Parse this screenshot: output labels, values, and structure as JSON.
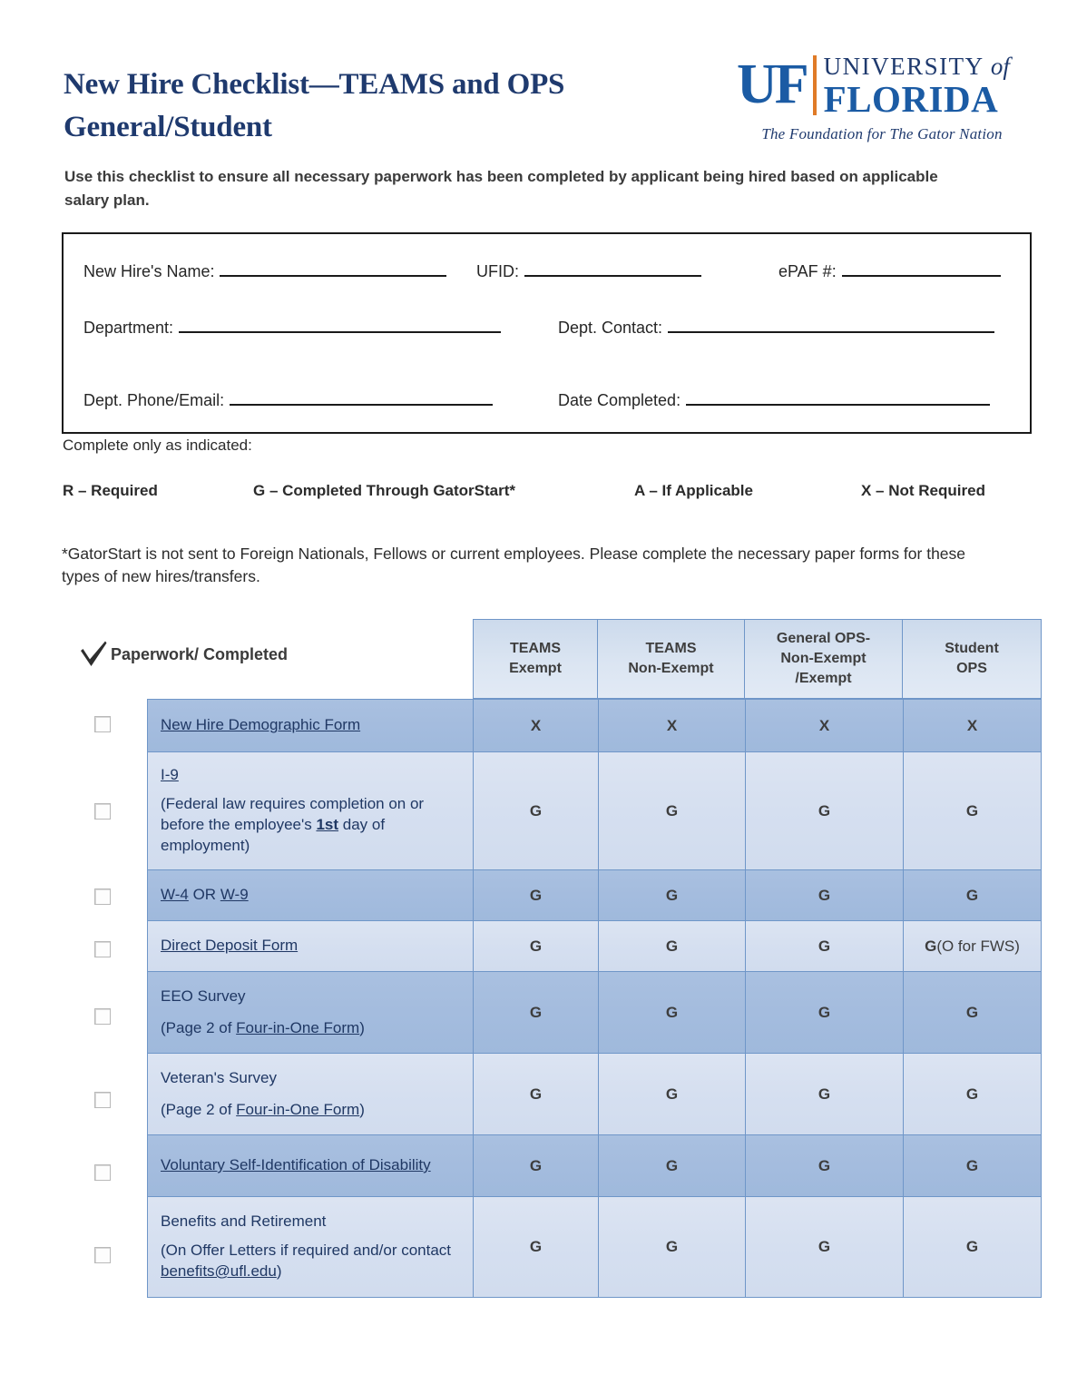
{
  "document": {
    "title_line1": "New Hire Checklist—TEAMS and OPS",
    "title_line2": "General/Student",
    "intro": "Use this checklist to ensure all necessary paperwork has been completed by applicant being hired based on applicable salary plan.",
    "complete_note": "Complete only as indicated:",
    "gatorstart_note": "*GatorStart is not sent to Foreign Nationals, Fellows or current employees. Please complete the necessary paper forms for these types of new hires/transfers."
  },
  "logo": {
    "mark": "UF",
    "university": "UNIVERSITY",
    "of": "of",
    "florida": "FLORIDA",
    "tagline": "The Foundation for The Gator Nation",
    "blue": "#1b5ba4",
    "navy": "#1f3a6e",
    "orange": "#e07b27"
  },
  "info_box": {
    "fields": [
      {
        "label": "New Hire's Name:",
        "value": "",
        "rule_width": 250
      },
      {
        "label": "UFID:",
        "value": "",
        "rule_width": 195
      },
      {
        "label": "ePAF #:",
        "value": "",
        "rule_width": 175
      },
      {
        "label": "Department:",
        "value": "",
        "rule_width": 355
      },
      {
        "label": "Dept. Contact:",
        "value": "",
        "rule_width": 360
      },
      {
        "label": "Dept. Phone/Email:",
        "value": "",
        "rule_width": 290
      },
      {
        "label": "Date Completed:",
        "value": "",
        "rule_width": 335
      }
    ]
  },
  "legend": [
    {
      "code": "R",
      "text": "R – Required"
    },
    {
      "code": "G",
      "text": "G – Completed Through GatorStart*"
    },
    {
      "code": "A",
      "text": "A – If Applicable"
    },
    {
      "code": "X",
      "text": "X – Not Required"
    }
  ],
  "table": {
    "check_header_label": "Paperwork/ Completed",
    "columns": [
      "TEAMS Exempt",
      "TEAMS Non-Exempt",
      "General OPS-Non-Exempt /Exempt",
      "Student OPS"
    ],
    "column_lines": [
      [
        "TEAMS",
        "Exempt"
      ],
      [
        "TEAMS",
        "Non-Exempt"
      ],
      [
        "General OPS-",
        "Non-Exempt",
        "/Exempt"
      ],
      [
        "Student",
        "OPS"
      ]
    ],
    "rows": [
      {
        "name": "New Hire Demographic Form",
        "sub": "",
        "shade": "dark",
        "values": [
          "X",
          "X",
          "X",
          "X"
        ],
        "student_extra": ""
      },
      {
        "name": "I-9",
        "sub": "(Federal law requires completion on or before the employee's 1st day of employment)",
        "sub_parts": [
          "(Federal law requires completion on or before the employee's ",
          "1st",
          " day of employment)"
        ],
        "shade": "light",
        "values": [
          "G",
          "G",
          "G",
          "G"
        ],
        "student_extra": ""
      },
      {
        "name": "W-4 OR W-9",
        "name_parts": [
          "W-4",
          " OR ",
          "W-9"
        ],
        "sub": "",
        "shade": "dark",
        "values": [
          "G",
          "G",
          "G",
          "G"
        ],
        "student_extra": ""
      },
      {
        "name": "Direct Deposit Form",
        "sub": "",
        "shade": "light",
        "values": [
          "G",
          "G",
          "G",
          "G"
        ],
        "student_extra": " (O for FWS)"
      },
      {
        "name": "EEO Survey",
        "sub": "(Page 2 of Four-in-One Form)",
        "sub_parts": [
          "(Page 2 of ",
          "Four-in-One Form",
          ")"
        ],
        "shade": "dark",
        "values": [
          "G",
          "G",
          "G",
          "G"
        ],
        "student_extra": ""
      },
      {
        "name": "Veteran's Survey",
        "sub": "(Page 2 of Four-in-One Form)",
        "sub_parts": [
          "(Page 2 of ",
          "Four-in-One Form",
          ")"
        ],
        "shade": "light",
        "values": [
          "G",
          "G",
          "G",
          "G"
        ],
        "student_extra": ""
      },
      {
        "name": "Voluntary Self-Identification of Disability",
        "sub": "",
        "shade": "dark",
        "values": [
          "G",
          "G",
          "G",
          "G"
        ],
        "student_extra": ""
      },
      {
        "name": "Benefits and Retirement",
        "sub": "(On Offer Letters if required and/or contact benefits@ufl.edu)",
        "sub_parts": [
          "(On Offer Letters if required and/or contact ",
          "benefits@ufl.edu",
          ")"
        ],
        "shade": "light",
        "values": [
          "G",
          "G",
          "G",
          "G"
        ],
        "student_extra": ""
      }
    ]
  },
  "colors": {
    "title_blue": "#1f3a6e",
    "row_dark": "#a4bcde",
    "row_light": "#d5dff0",
    "header_fill": "#d9e2f0",
    "grid_line": "#6f96c8",
    "link_text": "#203864"
  }
}
